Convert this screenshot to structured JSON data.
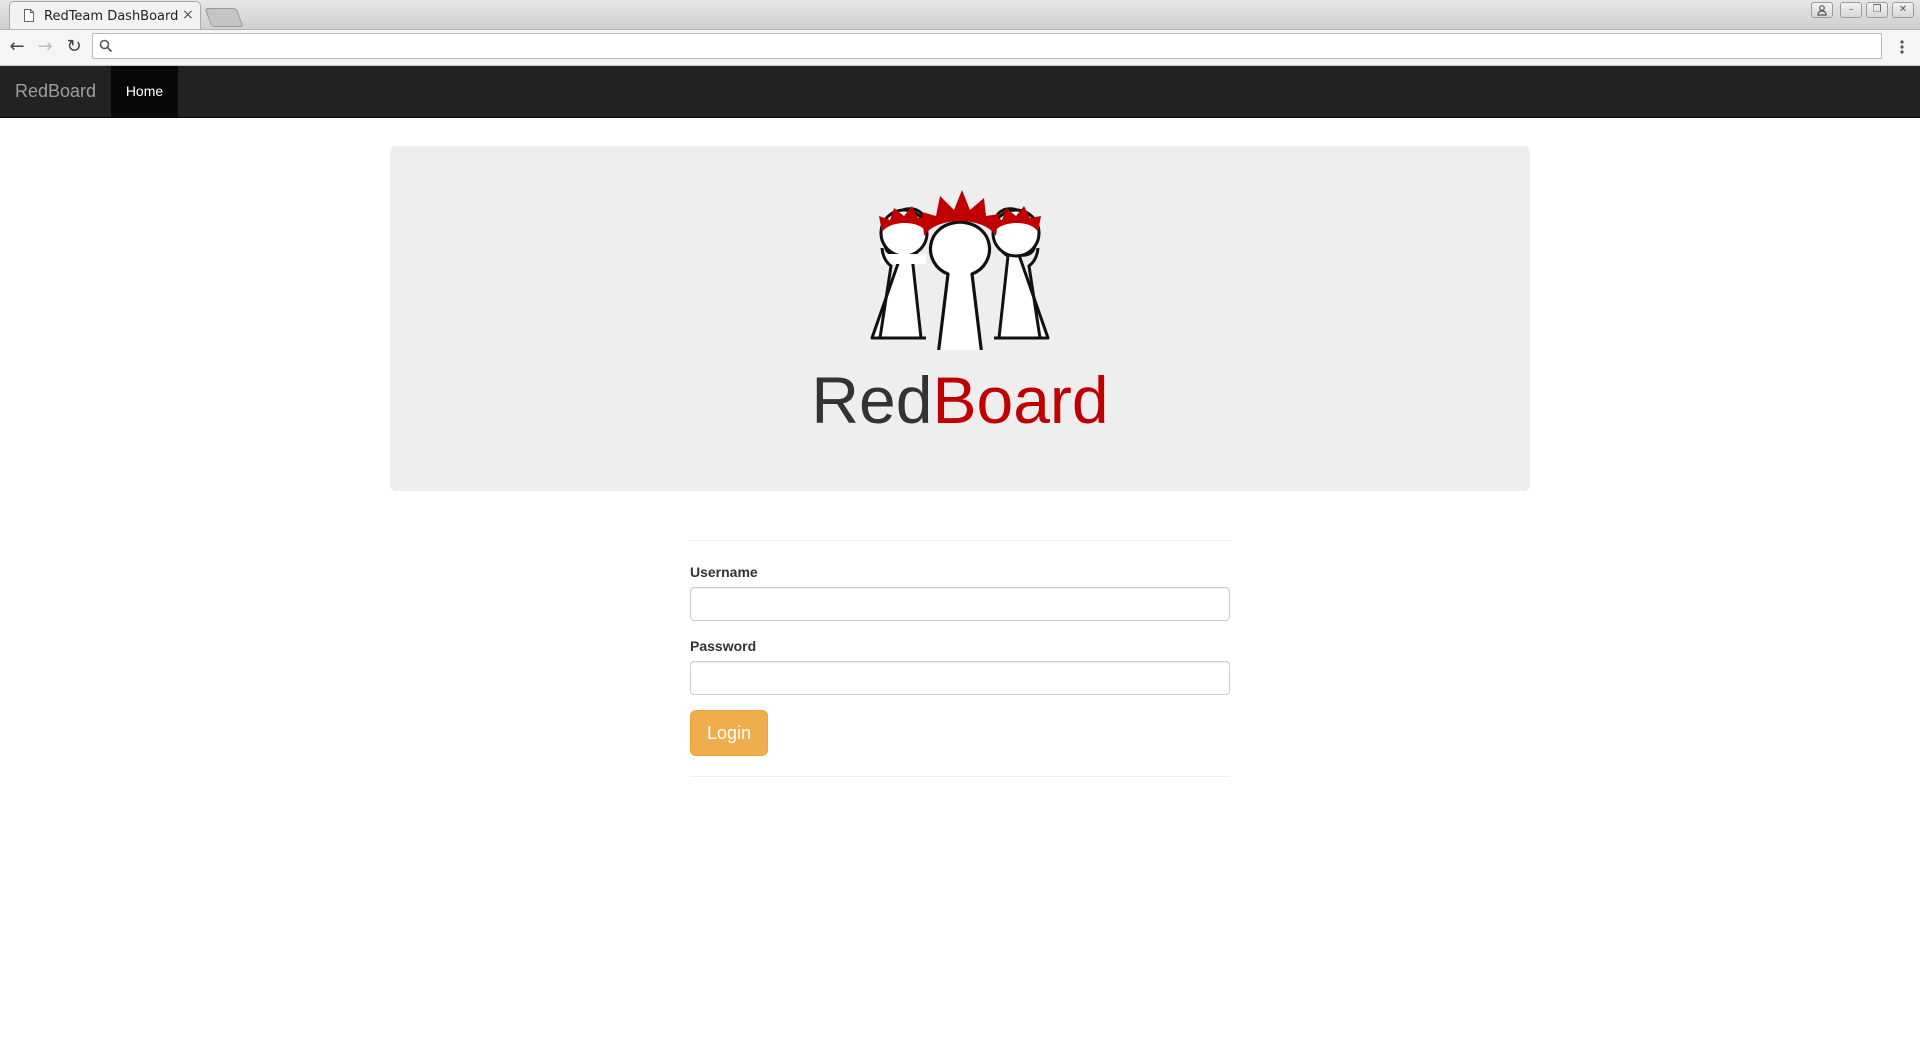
{
  "browser": {
    "tab_title": "RedTeam DashBoard",
    "tab_close": "×",
    "address_value": "",
    "icons": [
      "page-icon",
      "close-icon",
      "new-tab-icon",
      "profile-icon",
      "minimize-icon",
      "restore-icon",
      "window-close-icon",
      "back-arrow-icon",
      "forward-arrow-icon",
      "reload-icon",
      "search-icon",
      "menu-icon"
    ],
    "nav": {
      "back": "←",
      "forward": "→",
      "reload": "↻"
    },
    "window": {
      "minimize": "–",
      "restore": "❐",
      "close": "✕"
    }
  },
  "navbar": {
    "brand": "RedBoard",
    "items": [
      {
        "label": "Home",
        "active": true
      }
    ],
    "background": "#222222"
  },
  "hero": {
    "logo_text_dark": "Red",
    "logo_text_red": "Board",
    "accent_color": "#c00000"
  },
  "form": {
    "username_label": "Username",
    "username_value": "",
    "password_label": "Password",
    "password_value": "",
    "login_label": "Login",
    "button_color": "#f0ad4e"
  }
}
